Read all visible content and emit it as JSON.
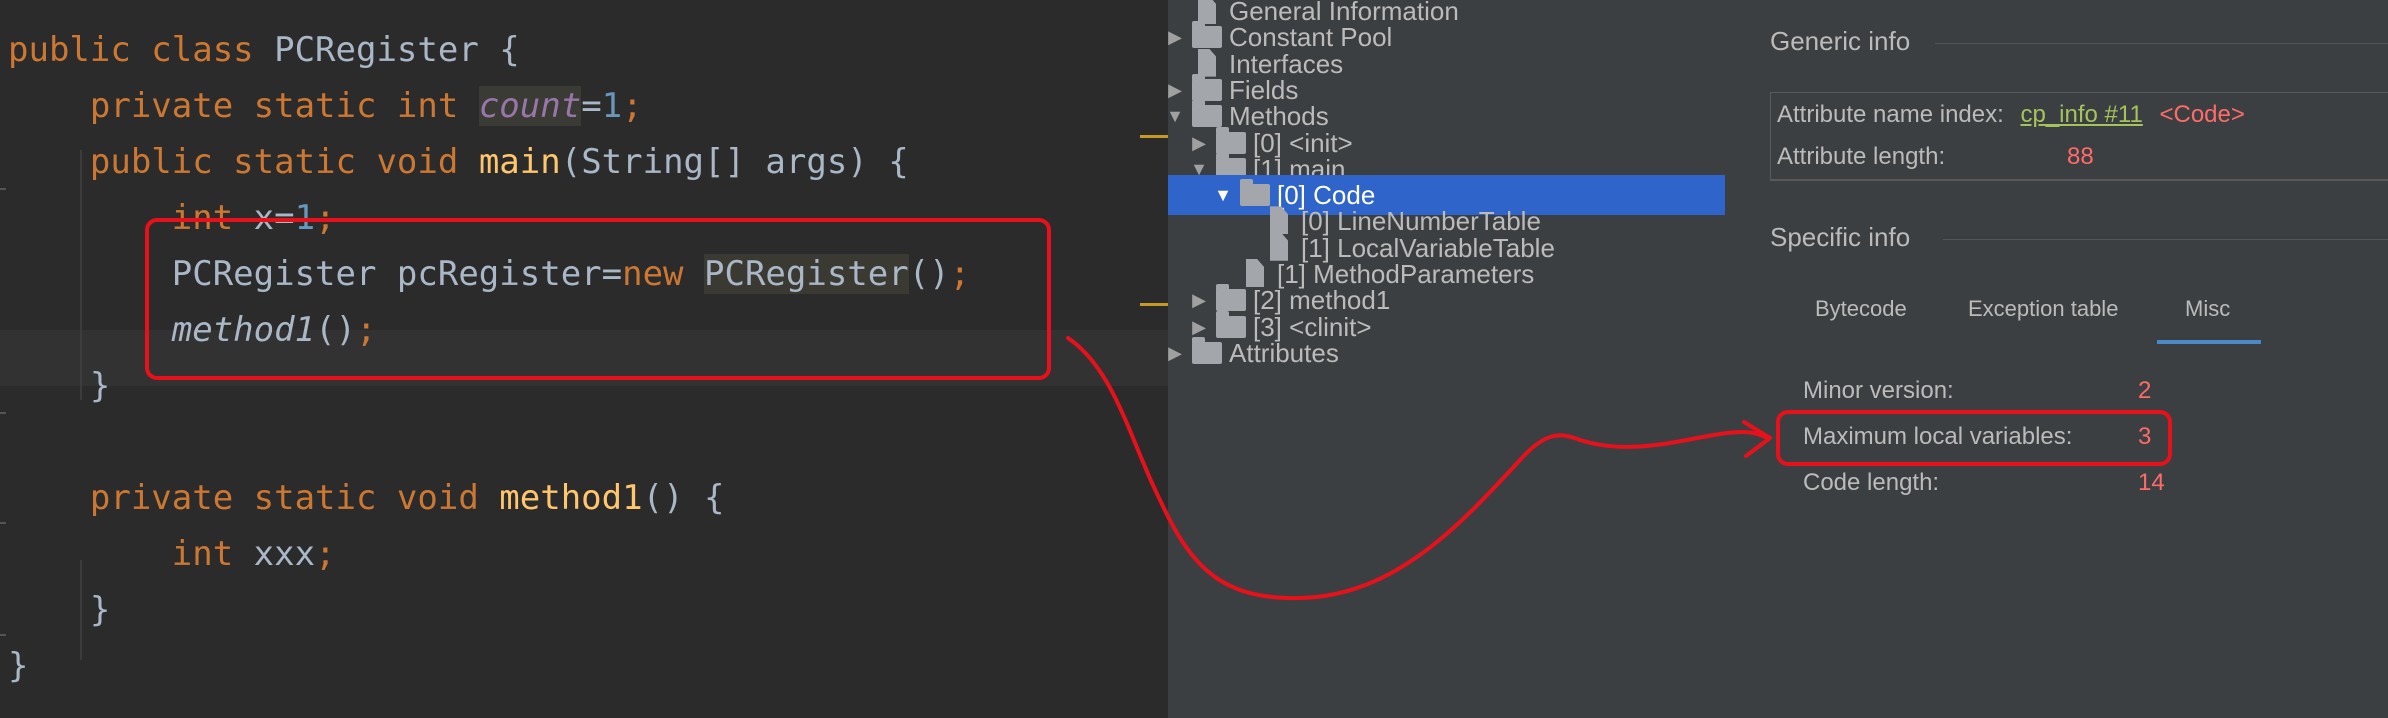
{
  "editor": {
    "lines": [
      {
        "indent": 0,
        "tokens": [
          {
            "t": "public class ",
            "c": "kw"
          },
          {
            "t": "PCRegister {",
            "c": ""
          }
        ]
      },
      {
        "indent": 1,
        "tokens": [
          {
            "t": "private static int ",
            "c": "kw"
          },
          {
            "t": "count",
            "c": "static-field"
          },
          {
            "t": "=",
            "c": ""
          },
          {
            "t": "1",
            "c": "num"
          },
          {
            "t": ";",
            "c": "kw"
          }
        ]
      },
      {
        "indent": 1,
        "tokens": [
          {
            "t": "public static void ",
            "c": "kw"
          },
          {
            "t": "main",
            "c": "method-decl"
          },
          {
            "t": "(String[] args) {",
            "c": ""
          }
        ]
      },
      {
        "indent": 2,
        "tokens": [
          {
            "t": "int ",
            "c": "kw"
          },
          {
            "t": "x=",
            "c": ""
          },
          {
            "t": "1",
            "c": "num"
          },
          {
            "t": ";",
            "c": "kw"
          }
        ]
      },
      {
        "indent": 2,
        "tokens": [
          {
            "t": "PCRegister pcRegister=",
            "c": ""
          },
          {
            "t": "new ",
            "c": "kw"
          },
          {
            "t": "PCRegister",
            "c": "highlight"
          },
          {
            "t": "()",
            "c": ""
          },
          {
            "t": ";",
            "c": "kw"
          }
        ]
      },
      {
        "indent": 2,
        "tokens": [
          {
            "t": "method1",
            "c": "ital"
          },
          {
            "t": "()",
            "c": ""
          },
          {
            "t": ";",
            "c": "kw"
          }
        ]
      },
      {
        "indent": 1,
        "tokens": [
          {
            "t": "}",
            "c": ""
          }
        ]
      },
      {
        "indent": 0,
        "tokens": []
      },
      {
        "indent": 1,
        "tokens": [
          {
            "t": "private static void ",
            "c": "kw"
          },
          {
            "t": "method1",
            "c": "method-decl"
          },
          {
            "t": "() {",
            "c": ""
          }
        ]
      },
      {
        "indent": 2,
        "tokens": [
          {
            "t": "int ",
            "c": "kw"
          },
          {
            "t": "xxx",
            "c": ""
          },
          {
            "t": ";",
            "c": "kw"
          }
        ]
      },
      {
        "indent": 1,
        "tokens": [
          {
            "t": "}",
            "c": ""
          }
        ]
      },
      {
        "indent": 0,
        "tokens": [
          {
            "t": "}",
            "c": ""
          }
        ]
      }
    ]
  },
  "tree": {
    "items": [
      {
        "label": "General Information",
        "depth": 0,
        "icon": "file",
        "arrow": ""
      },
      {
        "label": "Constant Pool",
        "depth": 0,
        "icon": "folder",
        "arrow": "▶"
      },
      {
        "label": "Interfaces",
        "depth": 0,
        "icon": "file",
        "arrow": ""
      },
      {
        "label": "Fields",
        "depth": 0,
        "icon": "folder",
        "arrow": "▶"
      },
      {
        "label": "Methods",
        "depth": 0,
        "icon": "folder",
        "arrow": "▼"
      },
      {
        "label": "[0] <init>",
        "depth": 1,
        "icon": "folder",
        "arrow": "▶"
      },
      {
        "label": "[1] main",
        "depth": 1,
        "icon": "folder",
        "arrow": "▼"
      },
      {
        "label": "[0] Code",
        "depth": 2,
        "icon": "folder",
        "arrow": "▼",
        "selected": true
      },
      {
        "label": "[0] LineNumberTable",
        "depth": 3,
        "icon": "file",
        "arrow": ""
      },
      {
        "label": "[1] LocalVariableTable",
        "depth": 3,
        "icon": "file",
        "arrow": ""
      },
      {
        "label": "[1] MethodParameters",
        "depth": 2,
        "icon": "file",
        "arrow": ""
      },
      {
        "label": "[2] method1",
        "depth": 1,
        "icon": "folder",
        "arrow": "▶"
      },
      {
        "label": "[3] <clinit>",
        "depth": 1,
        "icon": "folder",
        "arrow": "▶"
      },
      {
        "label": "Attributes",
        "depth": 0,
        "icon": "folder",
        "arrow": "▶"
      }
    ]
  },
  "info": {
    "generic_title": "Generic info",
    "attr_name_label": "Attribute name index:",
    "attr_name_link": "cp_info #11",
    "attr_name_value": "<Code>",
    "attr_length_label": "Attribute length:",
    "attr_length_value": "88",
    "specific_title": "Specific info",
    "tabs": [
      "Bytecode",
      "Exception table",
      "Misc"
    ],
    "active_tab": "Misc",
    "misc": [
      {
        "label": "Minor version:",
        "value": "2"
      },
      {
        "label": "Maximum local variables:",
        "value": "3"
      },
      {
        "label": "Code length:",
        "value": "14"
      }
    ]
  },
  "colors": {
    "annotation": "#e8101a",
    "selection": "#2f65ca",
    "tab_accent": "#4a88c7",
    "value_red": "#ff6b68"
  }
}
